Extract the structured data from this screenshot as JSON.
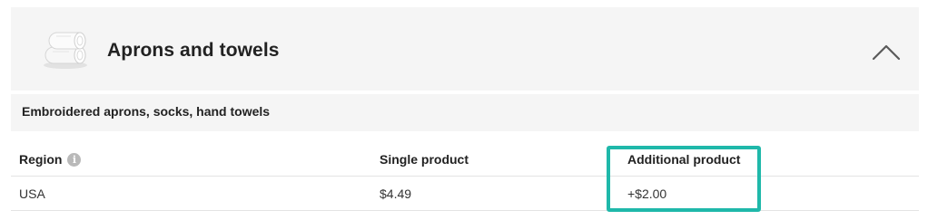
{
  "section": {
    "title": "Aprons and towels",
    "subtitle": "Embroidered aprons, socks, hand towels",
    "thumbnail_icon": "folded-towels-icon",
    "toggle_icon": "chevron-up-icon"
  },
  "table": {
    "columns": [
      "Region",
      "Single product",
      "Additional product"
    ],
    "region_info_icon": "info-icon",
    "rows": [
      {
        "region": "USA",
        "single": "$4.49",
        "additional": "+$2.00"
      }
    ]
  },
  "colors": {
    "header_background": "#f5f5f5",
    "highlight_border": "#1fb8aa",
    "info_icon": "#b9b9b9"
  }
}
